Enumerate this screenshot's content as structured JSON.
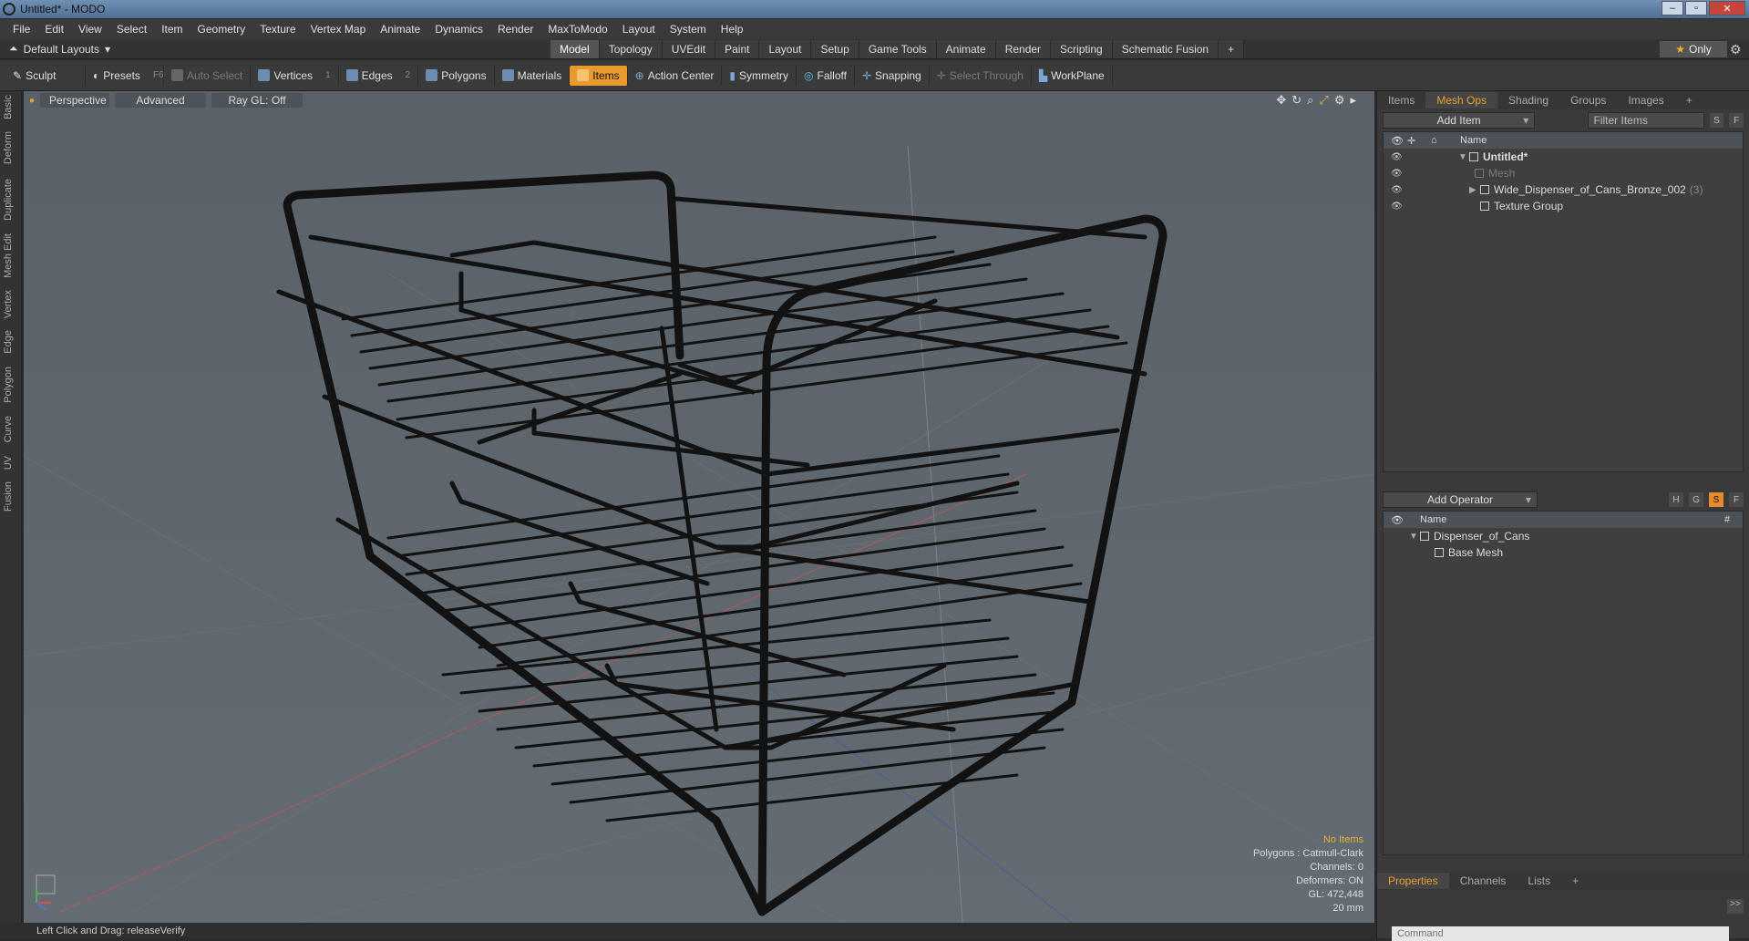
{
  "window": {
    "title": "Untitled* - MODO"
  },
  "menu": [
    "File",
    "Edit",
    "View",
    "Select",
    "Item",
    "Geometry",
    "Texture",
    "Vertex Map",
    "Animate",
    "Dynamics",
    "Render",
    "MaxToModo",
    "Layout",
    "System",
    "Help"
  ],
  "layout": {
    "selector": "Default Layouts",
    "tabs": [
      "Model",
      "Topology",
      "UVEdit",
      "Paint",
      "Layout",
      "Setup",
      "Game Tools",
      "Animate",
      "Render",
      "Scripting",
      "Schematic Fusion"
    ],
    "active_tab": "Model",
    "only_label": "Only"
  },
  "toolbar": {
    "sculpt": "Sculpt",
    "presets": "Presets",
    "presets_key": "F6",
    "auto_select": "Auto Select",
    "vertices": "Vertices",
    "vertices_key": "1",
    "edges": "Edges",
    "edges_key": "2",
    "polygons": "Polygons",
    "materials": "Materials",
    "items": "Items",
    "action_center": "Action Center",
    "symmetry": "Symmetry",
    "falloff": "Falloff",
    "snapping": "Snapping",
    "select_through": "Select Through",
    "workplane": "WorkPlane"
  },
  "left_tabs": [
    "Basic",
    "Deform",
    "Duplicate",
    "Mesh Edit",
    "Vertex",
    "Edge",
    "Polygon",
    "Curve",
    "UV",
    "Fusion"
  ],
  "viewport": {
    "perspective": "Perspective",
    "advanced": "Advanced",
    "raygl": "Ray GL: Off",
    "info": {
      "no_items": "No Items",
      "polygons": "Polygons : Catmull-Clark",
      "channels": "Channels: 0",
      "deformers": "Deformers: ON",
      "gl": "GL: 472,448",
      "scale": "20 mm"
    }
  },
  "statusbar": {
    "text": "Left Click and Drag:  releaseVerify"
  },
  "items_panel": {
    "tabs": [
      "Items",
      "Mesh Ops",
      "Shading",
      "Groups",
      "Images"
    ],
    "active_tab": "Mesh Ops",
    "add_item": "Add Item",
    "filter": "Filter Items",
    "name_header": "Name",
    "tree": [
      {
        "label": "Untitled*",
        "bold": true
      },
      {
        "label": "Mesh",
        "dim": true
      },
      {
        "label": "Wide_Dispenser_of_Cans_Bronze_002",
        "count": "(3)"
      },
      {
        "label": "Texture Group"
      }
    ]
  },
  "operator_panel": {
    "add_operator": "Add Operator",
    "name_header": "Name",
    "hash_header": "#",
    "tree": [
      {
        "label": "Dispenser_of_Cans"
      },
      {
        "label": "Base Mesh"
      }
    ]
  },
  "bottom_panel": {
    "tabs": [
      "Properties",
      "Channels",
      "Lists"
    ],
    "active_tab": "Properties",
    "command_placeholder": "Command"
  }
}
